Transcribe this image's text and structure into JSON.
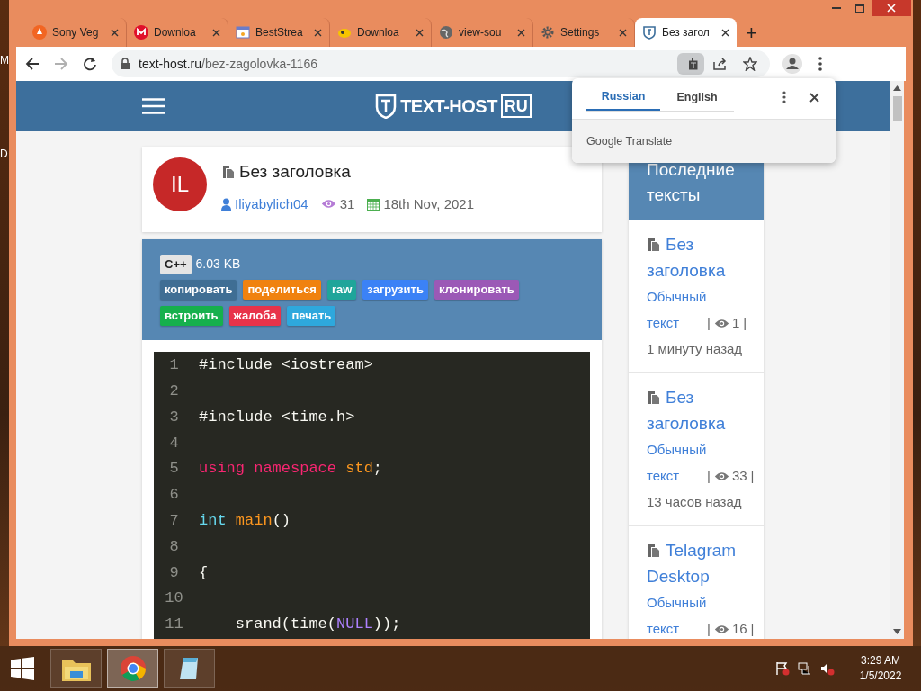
{
  "desktop": {
    "edge_labels": [
      "M",
      "D"
    ]
  },
  "browser": {
    "tabs": [
      {
        "title": "Sony Veg",
        "kind": "flame",
        "selected": false
      },
      {
        "title": "Downloa",
        "kind": "mail",
        "selected": false
      },
      {
        "title": "BestStrea",
        "kind": "window",
        "selected": false
      },
      {
        "title": "Downloa",
        "kind": "blob",
        "selected": false
      },
      {
        "title": "view-sou",
        "kind": "globe",
        "selected": false
      },
      {
        "title": "Settings",
        "kind": "gear",
        "selected": false
      },
      {
        "title": "Без загол",
        "kind": "site",
        "selected": true
      }
    ],
    "new_tab": "+",
    "nav": {
      "forward_disabled": true
    },
    "url": {
      "domain": "text-host.ru",
      "path": "/bez-zagolovka-1166"
    }
  },
  "site": {
    "logo": {
      "name": "TEXT-HOST",
      "suffix": "RU"
    },
    "post": {
      "avatar": "IL",
      "title": "Без заголовка",
      "author": "Iliyabylich04",
      "views": "31",
      "date": "18th Nov, 2021"
    },
    "toolbar": {
      "language": "C++",
      "size": "6.03 KB",
      "actions": [
        {
          "label": "копировать",
          "color": "#3f6e94"
        },
        {
          "label": "поделиться",
          "color": "#f0820f"
        },
        {
          "label": "raw",
          "color": "#1fa59a"
        },
        {
          "label": "загрузить",
          "color": "#3b82f6"
        },
        {
          "label": "клонировать",
          "color": "#9b59b6"
        },
        {
          "label": "встроить",
          "color": "#16b04d"
        },
        {
          "label": "жалоба",
          "color": "#e8334a"
        },
        {
          "label": "печать",
          "color": "#2ea8dd"
        }
      ]
    },
    "code": [
      {
        "n": "1",
        "tokens": [
          {
            "t": "#include <iostream>",
            "kind": "plain"
          }
        ]
      },
      {
        "n": "2"
      },
      {
        "n": "3",
        "tokens": [
          {
            "t": "#include <time.h>",
            "kind": "plain"
          }
        ]
      },
      {
        "n": "4"
      },
      {
        "n": "5",
        "tokens": [
          {
            "t": "using namespace ",
            "kind": "keyword"
          },
          {
            "t": "std",
            "kind": "name"
          },
          {
            "t": ";",
            "kind": "plain"
          }
        ]
      },
      {
        "n": "6"
      },
      {
        "n": "7",
        "tokens": [
          {
            "t": "int ",
            "kind": "type"
          },
          {
            "t": "main",
            "kind": "name"
          },
          {
            "t": "()",
            "kind": "plain"
          }
        ]
      },
      {
        "n": "8"
      },
      {
        "n": "9",
        "tokens": [
          {
            "t": "{",
            "kind": "plain"
          }
        ]
      },
      {
        "n": "10"
      },
      {
        "n": "11",
        "tokens": [
          {
            "t": "    srand(time(",
            "kind": "plain"
          },
          {
            "t": "NULL",
            "kind": "constant"
          },
          {
            "t": "));",
            "kind": "plain"
          }
        ]
      }
    ],
    "sidebar": {
      "heading": "Последние тексты",
      "items": [
        {
          "title": "Без заголовка",
          "type": "Обычный текст",
          "sep1": "|",
          "views": "1",
          "sep2": "|",
          "time": "1 минуту назад"
        },
        {
          "title": "Без заголовка",
          "type": "Обычный текст",
          "sep1": "|",
          "views": "33",
          "sep2": "|",
          "time": "13 часов назад"
        },
        {
          "title": "Telagram Desktop",
          "type": "Обычный текст",
          "sep1": "|",
          "views": "16",
          "sep2": "|"
        }
      ]
    }
  },
  "translate_popup": {
    "languages": [
      {
        "label": "Russian",
        "selected": true
      },
      {
        "label": "English",
        "selected": false
      }
    ],
    "brand": "Google Translate"
  },
  "taskbar": {
    "apps": [
      {
        "kind": "folder",
        "selected": false
      },
      {
        "kind": "chrome",
        "selected": true
      },
      {
        "kind": "notepad",
        "selected": false
      }
    ],
    "time": "3:29 AM",
    "date": "1/5/2022"
  }
}
